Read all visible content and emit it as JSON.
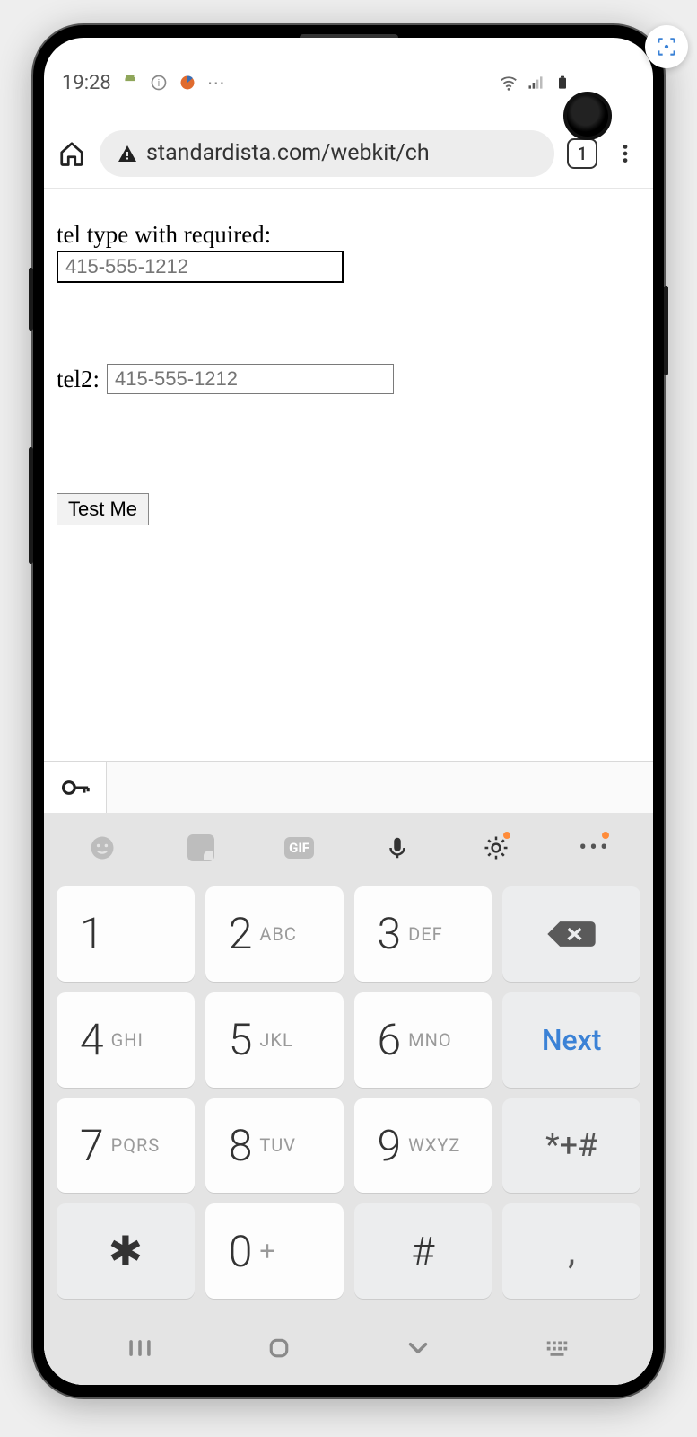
{
  "status": {
    "time": "19:28",
    "left_icons": [
      "android-icon",
      "info-icon",
      "browser-icon",
      "more-icon"
    ],
    "right_icons": [
      "wifi-icon",
      "signal-icon",
      "battery-icon"
    ]
  },
  "chrome": {
    "url": "standardista.com/webkit/ch",
    "tab_count": "1"
  },
  "page": {
    "label1": "tel type with required:",
    "input1_placeholder": "415-555-1212",
    "label2": "tel2:",
    "input2_placeholder": "415-555-1212",
    "button_label": "Test Me"
  },
  "keyboard": {
    "toolbar": [
      "emoji-icon",
      "sticker-icon",
      "gif-icon",
      "mic-icon",
      "settings-icon",
      "more-icon"
    ],
    "keys": [
      {
        "d": "1",
        "l": ""
      },
      {
        "d": "2",
        "l": "ABC"
      },
      {
        "d": "3",
        "l": "DEF"
      },
      {
        "d": "⌫",
        "l": "",
        "special": "backspace"
      },
      {
        "d": "4",
        "l": "GHI"
      },
      {
        "d": "5",
        "l": "JKL"
      },
      {
        "d": "6",
        "l": "MNO"
      },
      {
        "d": "Next",
        "l": "",
        "special": "next"
      },
      {
        "d": "7",
        "l": "PQRS"
      },
      {
        "d": "8",
        "l": "TUV"
      },
      {
        "d": "9",
        "l": "WXYZ"
      },
      {
        "d": "*+#",
        "l": "",
        "special": "sym"
      },
      {
        "d": "✱",
        "l": "",
        "special": "star"
      },
      {
        "d": "0",
        "l": "+"
      },
      {
        "d": "#",
        "l": "",
        "special": "hash"
      },
      {
        "d": ",",
        "l": "",
        "special": "comma"
      }
    ]
  },
  "navbar": [
    "recent-icon",
    "home-icon",
    "hide-kb-icon",
    "kb-layout-icon"
  ]
}
